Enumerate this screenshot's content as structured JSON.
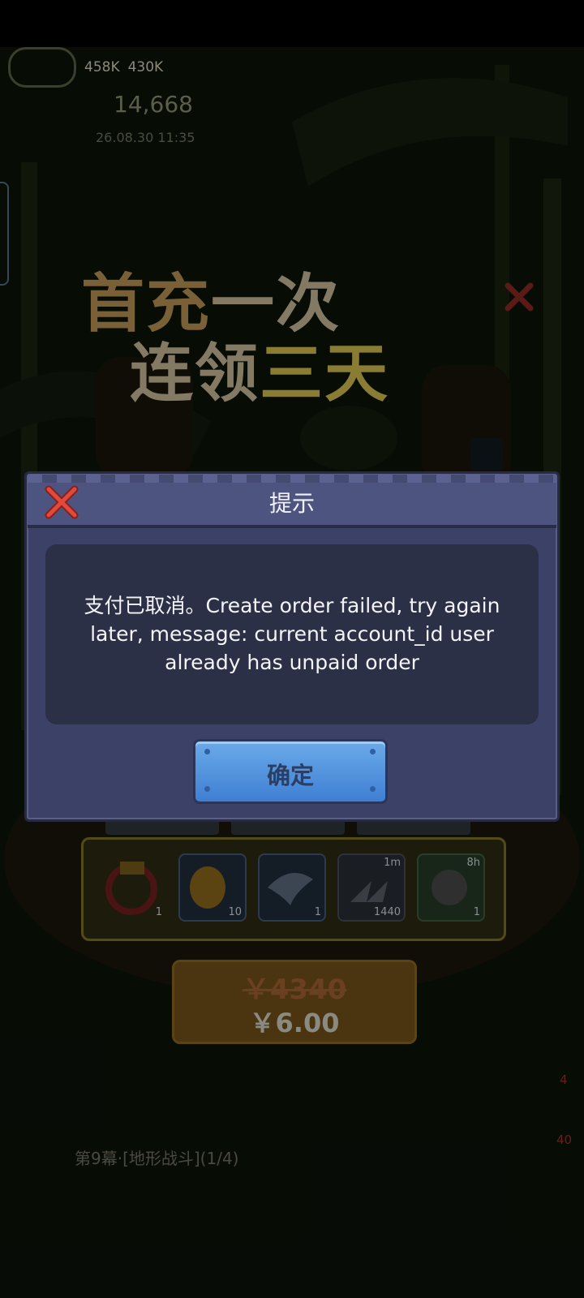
{
  "dialog": {
    "title": "提示",
    "message": "支付已取消。Create order failed, try again later, message: current account_id user already has unpaid order",
    "confirm_label": "确定"
  },
  "background": {
    "resources": [
      "458K",
      "430K"
    ],
    "gold": "14,668",
    "timestamp": "26.08.30 11:35",
    "banner_line1": [
      "首充",
      "一次"
    ],
    "banner_line2": [
      "连领",
      "三天"
    ],
    "items": [
      {
        "icon": "chest-ring-icon",
        "count": "1"
      },
      {
        "icon": "golden-bell-icon",
        "count": "10"
      },
      {
        "icon": "winged-bird-icon",
        "count": "1"
      },
      {
        "icon": "speed-arrow-icon",
        "count": "1440",
        "tag": "1m"
      },
      {
        "icon": "warrior-icon",
        "count": "1",
        "tag": "8h"
      }
    ],
    "price_original": "￥4340",
    "price_current": "￥6.00",
    "progress_text": "第9幕·[地形战斗](1/4)",
    "badges": [
      "4",
      "40"
    ]
  },
  "colors": {
    "dialog_body": "#2c3047",
    "dialog_shell": "#3c4167",
    "confirm_button": "#4f8fde",
    "close_x": "#d03a2f"
  }
}
